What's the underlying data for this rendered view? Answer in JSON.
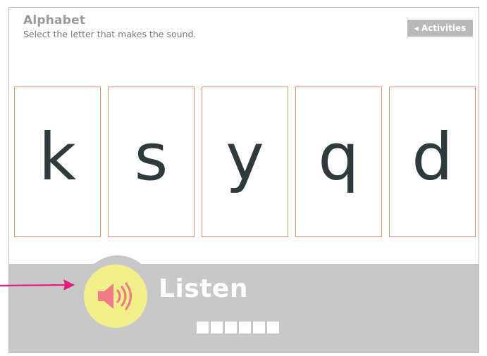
{
  "header": {
    "title": "Alphabet",
    "subtitle": "Select the letter that makes the sound.",
    "activities_label": "Activities"
  },
  "cards": [
    {
      "letter": "k"
    },
    {
      "letter": "s"
    },
    {
      "letter": "y"
    },
    {
      "letter": "q"
    },
    {
      "letter": "d"
    }
  ],
  "listen": {
    "label": "Listen",
    "icon": "speaker-icon"
  },
  "progress": {
    "total_steps": 6
  },
  "colors": {
    "card_border": "#ef8a7a",
    "letter": "#2f3a3d",
    "bottom_bar": "#c8c8c8",
    "speaker_bg": "#f0ef8a",
    "speaker_icon": "#f07a86",
    "annotation_arrow": "#e8197f"
  }
}
